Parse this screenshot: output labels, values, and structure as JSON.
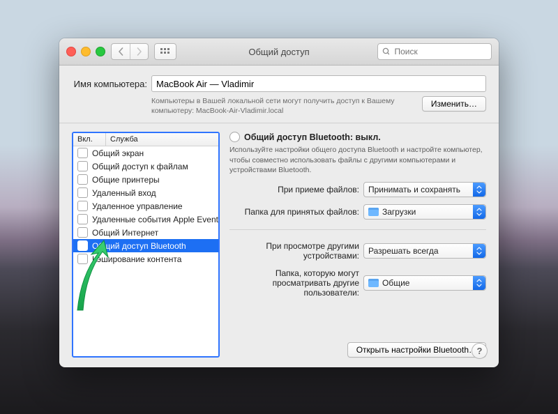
{
  "titlebar": {
    "title": "Общий доступ",
    "search_placeholder": "Поиск"
  },
  "top": {
    "name_label": "Имя компьютера:",
    "name_value": "MacBook Air — Vladimir",
    "subtext": "Компьютеры в Вашей локальной сети могут получить доступ к Вашему компьютеру: MacBook-Air-Vladimir.local",
    "edit_button": "Изменить…"
  },
  "services": {
    "col_on": "Вкл.",
    "col_service": "Служба",
    "items": [
      {
        "label": "Общий экран",
        "selected": false
      },
      {
        "label": "Общий доступ к файлам",
        "selected": false
      },
      {
        "label": "Общие принтеры",
        "selected": false
      },
      {
        "label": "Удаленный вход",
        "selected": false
      },
      {
        "label": "Удаленное управление",
        "selected": false
      },
      {
        "label": "Удаленные события Apple Events",
        "selected": false
      },
      {
        "label": "Общий Интернет",
        "selected": false
      },
      {
        "label": "Общий доступ Bluetooth",
        "selected": true
      },
      {
        "label": "Кэширование контента",
        "selected": false
      }
    ]
  },
  "right": {
    "heading": "Общий доступ Bluetooth: выкл.",
    "desc": "Используйте настройки общего доступа Bluetooth и настройте компьютер, чтобы совместно использовать файлы с другими компьютерами и устройствами Bluetooth.",
    "opt_receive_label": "При приеме файлов:",
    "opt_receive_value": "Принимать и сохранять",
    "opt_folder_in_label": "Папка для принятых файлов:",
    "opt_folder_in_value": "Загрузки",
    "opt_browse_label": "При просмотре другими устройствами:",
    "opt_browse_value": "Разрешать всегда",
    "opt_folder_browse_label": "Папка, которую могут просматривать другие пользователи:",
    "opt_folder_browse_value": "Общие",
    "open_bt_button": "Открыть настройки Bluetooth…"
  }
}
